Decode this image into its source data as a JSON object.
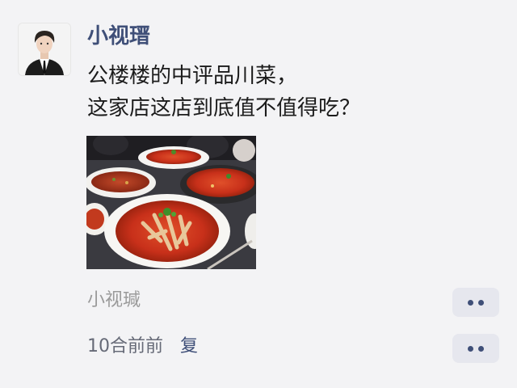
{
  "post": {
    "author": "小视瑨",
    "content_lines": [
      "公楼楼的中评品川菜，",
      "这家店这店到底值不值得吃？"
    ],
    "location": "小视瑊",
    "time": "10合前前",
    "delete_label": "复"
  },
  "icons": {
    "more_location": "more-dots-icon",
    "more_comment": "more-dots-icon"
  },
  "colors": {
    "author_name": "#3f4f78",
    "background": "#f3f3f5",
    "action_button_bg": "#e6e7ee"
  }
}
